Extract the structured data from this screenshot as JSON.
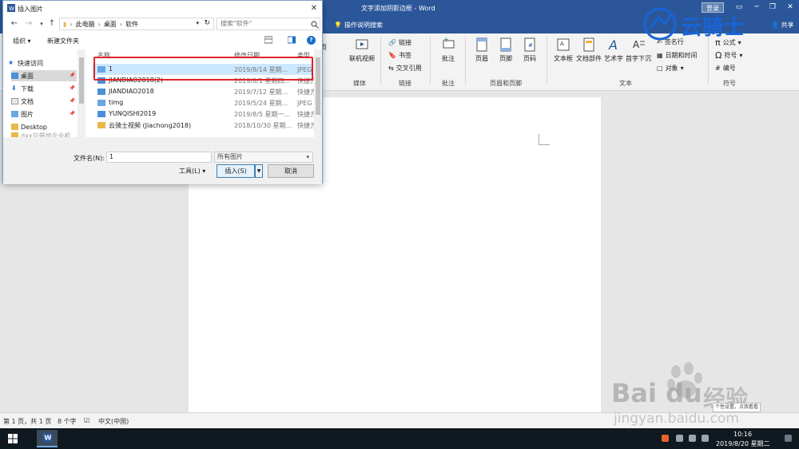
{
  "word": {
    "title": "文字添加阴影边框 - Word",
    "login": "登录",
    "tell_me": "操作说明搜索",
    "share": "共享",
    "ribbon": {
      "media": {
        "online_video": "联机视频",
        "label": "媒体"
      },
      "links": {
        "link": "链接",
        "bookmark": "书签",
        "cross_ref": "交叉引用",
        "label": "链接"
      },
      "comments": {
        "comment": "批注",
        "label": "批注"
      },
      "header_footer": {
        "header": "页眉",
        "footer": "页脚",
        "page_number": "页码",
        "label": "页眉和页脚"
      },
      "text": {
        "textbox": "文本框",
        "quick_parts": "文档部件",
        "wordart": "艺术字",
        "dropcap": "首字下沉",
        "signature_line": "签名行",
        "date_time": "日期和时间",
        "object": "对象",
        "label": "文本"
      },
      "symbols": {
        "equation": "公式",
        "symbol": "符号",
        "number": "编号",
        "label": "符号"
      },
      "partial": "页"
    },
    "status": {
      "page": "第 1 页，共 1 页",
      "words": "8 个字",
      "lang": "中文(中国)"
    }
  },
  "dialog": {
    "title": "插入图片",
    "path": [
      "此电脑",
      "桌面",
      "软件"
    ],
    "search_placeholder": "搜索\"软件\"",
    "organize": "组织 ▾",
    "new_folder": "新建文件夹",
    "nav": [
      {
        "label": "快速访问",
        "icon": "star-icon"
      },
      {
        "label": "桌面",
        "icon": "folder-blue-icon",
        "pinned": true
      },
      {
        "label": "下载",
        "icon": "download-icon",
        "pinned": true
      },
      {
        "label": "文档",
        "icon": "document-icon",
        "pinned": true
      },
      {
        "label": "图片",
        "icon": "picture-icon",
        "pinned": true
      },
      {
        "label": "Desktop",
        "icon": "folder-icon"
      },
      {
        "label": "dxx只带加企业机",
        "icon": "folder-icon"
      }
    ],
    "columns": {
      "name": "名称",
      "date": "修改日期",
      "type": "类型"
    },
    "files": [
      {
        "name": "1",
        "date": "2019/8/14 星期...",
        "type": "JPEG 图",
        "icon": "image-file-icon",
        "selected": true
      },
      {
        "name": "JIANDIAO2018(2)",
        "date": "2019/8/1 星期四...",
        "type": "快捷方",
        "icon": "shortcut-icon"
      },
      {
        "name": "JIANDIAO2018",
        "date": "2019/7/12 星期...",
        "type": "快捷方",
        "icon": "shortcut-icon"
      },
      {
        "name": "timg",
        "date": "2019/5/24 星期...",
        "type": "JPEG 图",
        "icon": "image-file-icon"
      },
      {
        "name": "YUNQISHI2019",
        "date": "2019/8/5 星期一...",
        "type": "快捷方",
        "icon": "shortcut-icon"
      },
      {
        "name": "云骑士视频 (Jiachong2018)",
        "date": "2018/10/30 星期...",
        "type": "快捷方",
        "icon": "shortcut-icon"
      }
    ],
    "filename_label": "文件名(N):",
    "filename_value": "1",
    "filter": "所有图片",
    "tools": "工具(L)  ▾",
    "insert": "插入(S)",
    "cancel": "取消"
  },
  "taskbar": {
    "time": "10:16",
    "date": "2019/8/20 星期二"
  },
  "watermark": {
    "brand": "云骑士",
    "baidu": "Bai du",
    "baidu_cn": "经验",
    "baidu_url": "jingyan.baidu.com",
    "tooltip": "个性设置，点我看看"
  },
  "colors": {
    "word_blue": "#2b579a",
    "highlight_red": "#e0232a",
    "selection": "#cce8ff"
  }
}
